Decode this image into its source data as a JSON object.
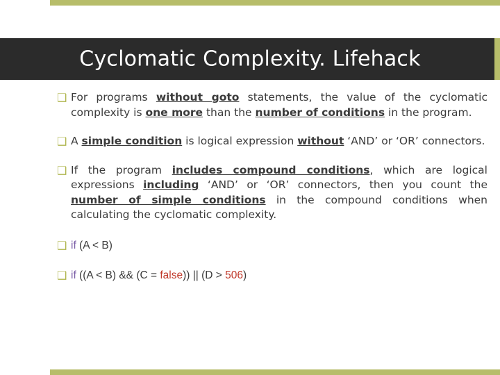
{
  "slide": {
    "title": "Cyclomatic Complexity. Lifehack",
    "accent_color": "#b7bd6a",
    "band_color": "#2b2b2b",
    "bullet_glyph": "❑",
    "bullets": [
      {
        "id": "b1",
        "parts": [
          {
            "t": "For programs ",
            "style": "normal"
          },
          {
            "t": "without goto",
            "style": "underline-bold"
          },
          {
            "t": " statements, the value of the cyclomatic complexity is ",
            "style": "normal"
          },
          {
            "t": "one more",
            "style": "underline-bold"
          },
          {
            "t": " than the ",
            "style": "normal"
          },
          {
            "t": "number of conditions",
            "style": "underline-bold"
          },
          {
            "t": " in the program.",
            "style": "normal"
          }
        ]
      },
      {
        "id": "b2",
        "parts": [
          {
            "t": "A ",
            "style": "normal"
          },
          {
            "t": "simple condition",
            "style": "underline-bold"
          },
          {
            "t": " is logical expression ",
            "style": "normal"
          },
          {
            "t": "without",
            "style": "underline-bold"
          },
          {
            "t": " ‘AND’ or ‘OR’ connectors.",
            "style": "normal"
          }
        ]
      },
      {
        "id": "b3",
        "parts": [
          {
            "t": "If the program ",
            "style": "normal"
          },
          {
            "t": "includes compound conditions",
            "style": "underline-bold"
          },
          {
            "t": ", which are logical expressions ",
            "style": "normal"
          },
          {
            "t": "including",
            "style": "underline-bold"
          },
          {
            "t": " ‘AND’ or ‘OR’ connectors, then you count the ",
            "style": "normal"
          },
          {
            "t": "number of simple conditions",
            "style": "underline-bold"
          },
          {
            "t": " in the compound conditions when calculating the cyclomatic complexity.",
            "style": "normal"
          }
        ]
      },
      {
        "id": "b4",
        "code": [
          {
            "t": "if",
            "color": "keyword"
          },
          {
            "t": " (A < B)",
            "color": "plain"
          }
        ]
      },
      {
        "id": "b5",
        "code": [
          {
            "t": "if",
            "color": "keyword"
          },
          {
            "t": " ((A < B) && (C = ",
            "color": "plain"
          },
          {
            "t": "false",
            "color": "value"
          },
          {
            "t": ")) || (D > ",
            "color": "plain"
          },
          {
            "t": "506",
            "color": "value"
          },
          {
            "t": ")",
            "color": "plain"
          }
        ]
      }
    ]
  }
}
